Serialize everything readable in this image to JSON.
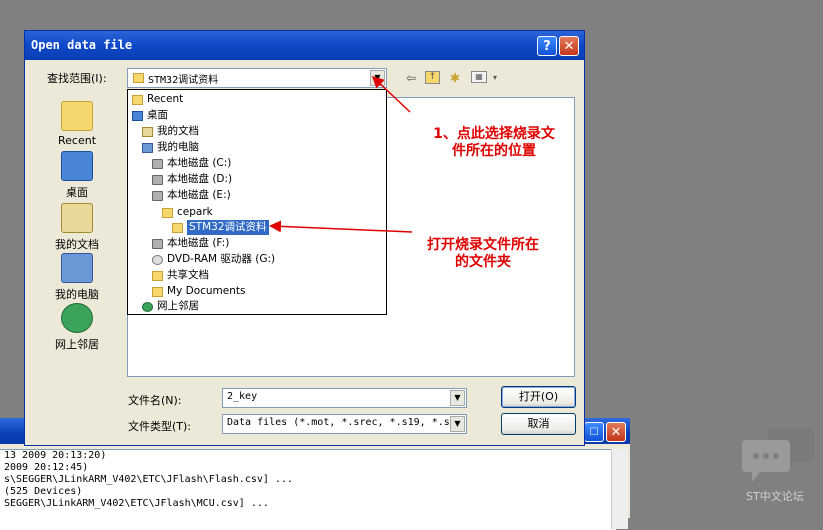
{
  "background_window": {
    "log_lines": [
      " 13 2009 20:13:20)",
      " 2009 20:12:45)",
      "s\\SEGGER\\JLinkARM_V402\\ETC\\JFlash\\Flash.csv] ...",
      " (525 Devices)",
      "SEGGER\\JLinkARM_V402\\ETC\\JFlash\\MCU.csv] ..."
    ]
  },
  "dialog": {
    "title": "Open data file",
    "help_button": "?",
    "close_button": "✕",
    "look_in_label": "查找范围(I):",
    "look_in_value": "STM32调试资料",
    "places": [
      {
        "label": "Recent",
        "icon": "recent-folder-icon"
      },
      {
        "label": "桌面",
        "icon": "desktop-icon"
      },
      {
        "label": "我的文档",
        "icon": "my-documents-icon"
      },
      {
        "label": "我的电脑",
        "icon": "my-computer-icon"
      },
      {
        "label": "网上邻居",
        "icon": "network-places-icon"
      }
    ],
    "dropdown_items": [
      {
        "label": "Recent",
        "icon": "folder-icon"
      },
      {
        "label": "桌面",
        "icon": "desktop-icon"
      },
      {
        "label": "我的文档",
        "icon": "my-documents-icon"
      },
      {
        "label": "我的电脑",
        "icon": "my-computer-icon"
      },
      {
        "label": "本地磁盘 (C:)",
        "icon": "drive-icon"
      },
      {
        "label": "本地磁盘 (D:)",
        "icon": "drive-icon"
      },
      {
        "label": "本地磁盘 (E:)",
        "icon": "drive-icon"
      },
      {
        "label": "cepark",
        "icon": "folder-icon"
      },
      {
        "label": "STM32调试资料",
        "icon": "folder-icon"
      },
      {
        "label": "本地磁盘 (F:)",
        "icon": "drive-icon"
      },
      {
        "label": "DVD-RAM 驱动器 (G:)",
        "icon": "dvd-icon"
      },
      {
        "label": "共享文档",
        "icon": "folder-icon"
      },
      {
        "label": "My Documents",
        "icon": "folder-icon"
      },
      {
        "label": "网上邻居",
        "icon": "network-icon"
      }
    ],
    "filename_label": "文件名(N):",
    "filename_value": "2_key",
    "filetype_label": "文件类型(T):",
    "filetype_value": "Data files (*.mot, *.srec, *.s19, *.s",
    "open_button": "打开(O)",
    "cancel_button": "取消"
  },
  "annotations": {
    "note1_line1": "1、点此选择烧录文",
    "note1_line2": "件所在的位置",
    "note2_line1": "打开烧录文件所在",
    "note2_line2": "的文件夹"
  },
  "logo": {
    "text": "ST中文论坛"
  },
  "colors": {
    "annotation": "#e00000",
    "selection": "#316ac5",
    "title_bar": "#0d48c8"
  }
}
